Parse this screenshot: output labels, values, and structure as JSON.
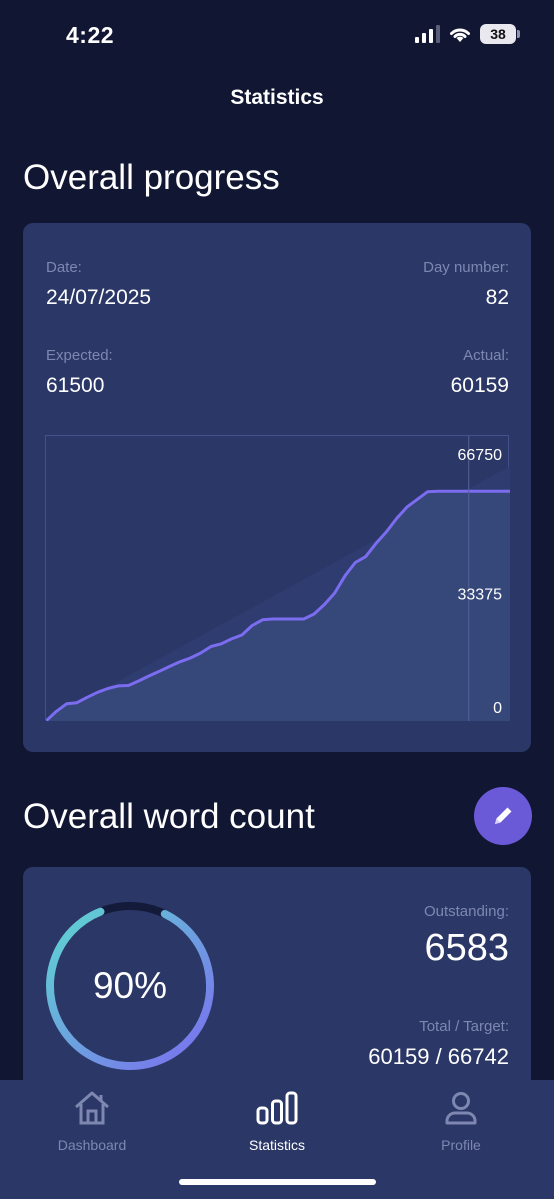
{
  "status_bar": {
    "time": "4:22",
    "battery": "38"
  },
  "nav": {
    "title": "Statistics"
  },
  "progress_section": {
    "title": "Overall progress",
    "date_label": "Date:",
    "date_value": "24/07/2025",
    "day_label": "Day number:",
    "day_value": "82",
    "expected_label": "Expected:",
    "expected_value": "61500",
    "actual_label": "Actual:",
    "actual_value": "60159"
  },
  "chart_data": {
    "type": "area",
    "x": [
      0,
      2,
      4,
      6,
      8,
      10,
      12,
      14,
      16,
      18,
      20,
      22,
      24,
      26,
      28,
      30,
      32,
      34,
      36,
      38,
      40,
      42,
      44,
      46,
      48,
      50,
      52,
      54,
      56,
      58,
      60,
      62,
      64,
      66,
      68,
      70,
      72,
      74,
      76,
      78,
      80,
      82,
      90
    ],
    "series": [
      {
        "values": [
          0,
          2500,
          4500,
          4800,
          6200,
          7500,
          8500,
          9200,
          9300,
          10500,
          11800,
          13000,
          14300,
          15500,
          16500,
          17800,
          19500,
          20200,
          21500,
          22500,
          25000,
          26500,
          26700,
          26700,
          26700,
          26700,
          28000,
          30500,
          33500,
          38000,
          41500,
          43000,
          46500,
          49500,
          53000,
          56000,
          58000,
          60000,
          60159,
          60159,
          60159,
          60159,
          60159
        ]
      },
      {
        "values": [
          0,
          66750
        ]
      }
    ],
    "expected_x": [
      0,
      90
    ],
    "ylim": [
      0,
      66750
    ],
    "xlim": [
      0,
      90
    ],
    "y_ticks": [
      "66750",
      "33375",
      "0"
    ],
    "today_marker_x": 82,
    "colors": {
      "actual_line": "#7b6cf0",
      "actual_fill": "#36477a",
      "expected_fill": "#2f3c70",
      "background": "#2b3766"
    }
  },
  "word_count_section": {
    "title": "Overall word count",
    "edit_icon": "pencil-icon",
    "percent": 0.9,
    "percent_text": "90%",
    "outstanding_label": "Outstanding:",
    "outstanding_value": "6583",
    "total_label": "Total / Target:",
    "total_value": "60159 / 66742"
  },
  "tabs": [
    {
      "label": "Dashboard",
      "icon": "home-icon",
      "active": false
    },
    {
      "label": "Statistics",
      "icon": "bar-chart-icon",
      "active": true
    },
    {
      "label": "Profile",
      "icon": "person-icon",
      "active": false
    }
  ]
}
